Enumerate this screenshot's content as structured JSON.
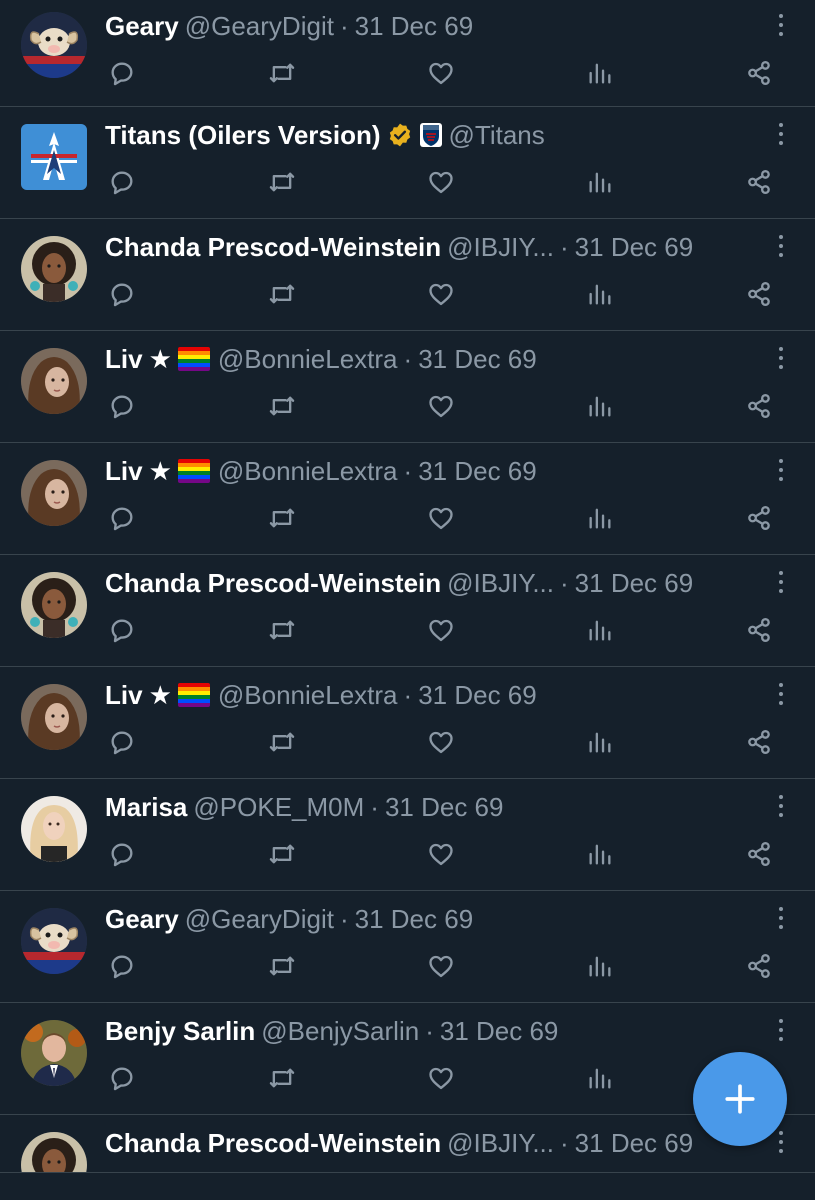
{
  "colors": {
    "background": "#15202b",
    "divider": "#38444d",
    "secondary_text": "#8b98a5",
    "fab": "#4a99e9",
    "verified_gold": "#e8b11e"
  },
  "fab": {
    "icon": "plus-icon"
  },
  "tweets": [
    {
      "name": "Geary",
      "handle": "@GearyDigit",
      "sep": "·",
      "time": "31 Dec 69",
      "avatar": "ram-mascot",
      "badges": []
    },
    {
      "name": "Titans (Oilers Version)",
      "handle": "@Titans",
      "sep": "",
      "time": "",
      "avatar": "oilers-logo",
      "badges": [
        "verified-gold",
        "nfl-logo"
      ]
    },
    {
      "name": "Chanda Prescod-Weinstein",
      "handle": "@IBJIY...",
      "sep": "·",
      "time": "31 Dec 69",
      "avatar": "person-curly-hair",
      "badges": []
    },
    {
      "name": "Liv",
      "handle": "@BonnieLextra",
      "sep": "·",
      "time": "31 Dec 69",
      "avatar": "person-wavy-hair",
      "badges": [
        "star",
        "rainbow-flag"
      ],
      "star_text": "★"
    },
    {
      "name": "Liv",
      "handle": "@BonnieLextra",
      "sep": "·",
      "time": "31 Dec 69",
      "avatar": "person-wavy-hair",
      "badges": [
        "star",
        "rainbow-flag"
      ],
      "star_text": "★"
    },
    {
      "name": "Chanda Prescod-Weinstein",
      "handle": "@IBJIY...",
      "sep": "·",
      "time": "31 Dec 69",
      "avatar": "person-curly-hair",
      "badges": []
    },
    {
      "name": "Liv",
      "handle": "@BonnieLextra",
      "sep": "·",
      "time": "31 Dec 69",
      "avatar": "person-wavy-hair",
      "badges": [
        "star",
        "rainbow-flag"
      ],
      "star_text": "★"
    },
    {
      "name": "Marisa",
      "handle": "@POKE_M0M",
      "sep": "·",
      "time": "31 Dec 69",
      "avatar": "person-blonde",
      "badges": []
    },
    {
      "name": "Geary",
      "handle": "@GearyDigit",
      "sep": "·",
      "time": "31 Dec 69",
      "avatar": "ram-mascot",
      "badges": []
    },
    {
      "name": "Benjy Sarlin",
      "handle": "@BenjySarlin",
      "sep": "·",
      "time": "31 Dec 69",
      "avatar": "person-suit",
      "badges": []
    },
    {
      "name": "Chanda Prescod-Weinstein",
      "handle": "@IBJIY...",
      "sep": "·",
      "time": "31 Dec 69",
      "avatar": "person-curly-hair",
      "badges": []
    }
  ],
  "action_icons": [
    "reply-icon",
    "retweet-icon",
    "like-icon",
    "views-icon",
    "share-icon"
  ]
}
